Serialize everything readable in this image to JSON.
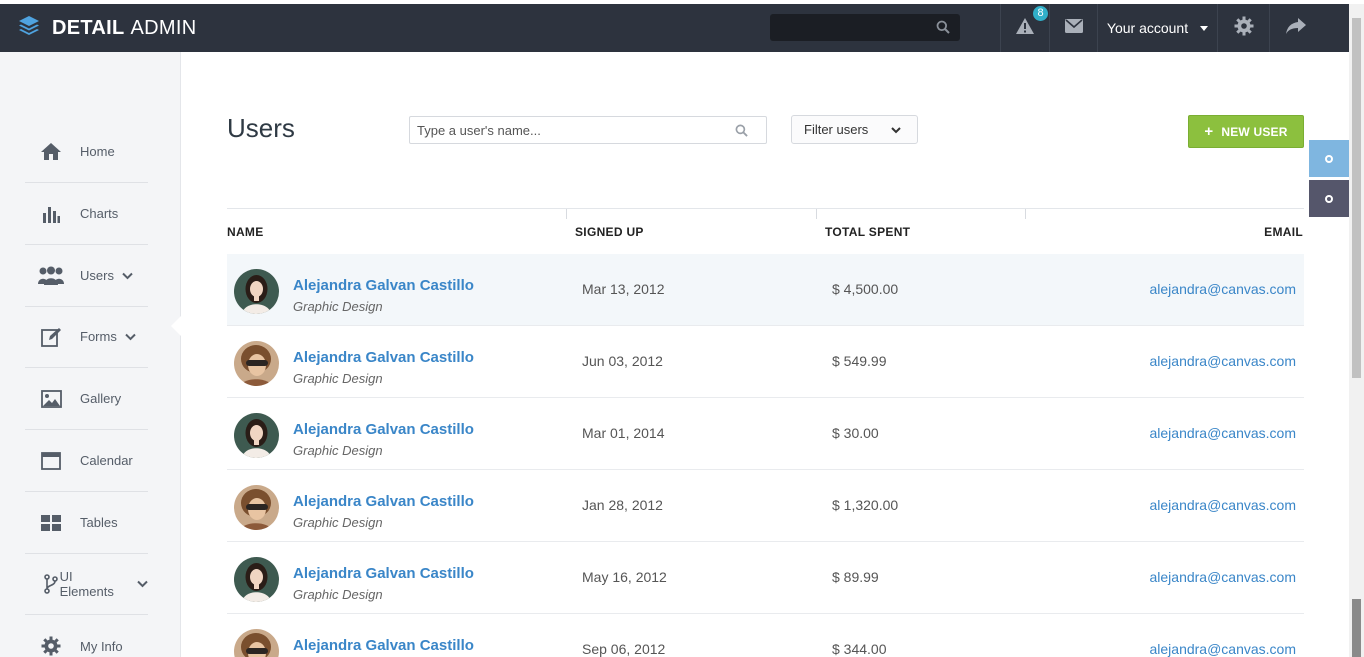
{
  "app": {
    "brand_bold": "DETAIL",
    "brand_light": "ADMIN"
  },
  "topbar": {
    "search_placeholder": "",
    "alerts_count": "8",
    "account_label": "Your account",
    "icons": [
      "search-icon",
      "alert-icon",
      "mail-icon",
      "gear-icon",
      "share-icon"
    ]
  },
  "sidebar": {
    "items": [
      {
        "label": "Home",
        "icon": "home-icon"
      },
      {
        "label": "Charts",
        "icon": "bar-chart-icon"
      },
      {
        "label": "Users",
        "icon": "users-icon",
        "expandable": true
      },
      {
        "label": "Forms",
        "icon": "edit-icon",
        "expandable": true
      },
      {
        "label": "Gallery",
        "icon": "image-icon"
      },
      {
        "label": "Calendar",
        "icon": "calendar-icon"
      },
      {
        "label": "Tables",
        "icon": "grid-icon"
      },
      {
        "label": "UI Elements",
        "icon": "branch-icon",
        "expandable": true
      },
      {
        "label": "My Info",
        "icon": "gear-icon"
      }
    ],
    "active": "Users"
  },
  "main": {
    "title": "Users",
    "search_placeholder": "Type a user's name...",
    "filter_label": "Filter users",
    "new_user_label": "NEW USER"
  },
  "table": {
    "columns": [
      "NAME",
      "SIGNED UP",
      "TOTAL SPENT",
      "EMAIL"
    ],
    "rows": [
      {
        "name": "Alejandra Galvan Castillo",
        "role": "Graphic Design",
        "signed_up": "Mar 13, 2012",
        "spent": "$ 4,500.00",
        "email": "alejandra@canvas.com",
        "avatar": "a"
      },
      {
        "name": "Alejandra Galvan Castillo",
        "role": "Graphic Design",
        "signed_up": "Jun 03, 2012",
        "spent": "$ 549.99",
        "email": "alejandra@canvas.com",
        "avatar": "b"
      },
      {
        "name": "Alejandra Galvan Castillo",
        "role": "Graphic Design",
        "signed_up": "Mar 01, 2014",
        "spent": "$ 30.00",
        "email": "alejandra@canvas.com",
        "avatar": "a"
      },
      {
        "name": "Alejandra Galvan Castillo",
        "role": "Graphic Design",
        "signed_up": "Jan 28, 2012",
        "spent": "$ 1,320.00",
        "email": "alejandra@canvas.com",
        "avatar": "b"
      },
      {
        "name": "Alejandra Galvan Castillo",
        "role": "Graphic Design",
        "signed_up": "May 16, 2012",
        "spent": "$ 89.99",
        "email": "alejandra@canvas.com",
        "avatar": "a"
      },
      {
        "name": "Alejandra Galvan Castillo",
        "role": "Graphic Design",
        "signed_up": "Sep 06, 2012",
        "spent": "$ 344.00",
        "email": "alejandra@canvas.com",
        "avatar": "b"
      }
    ]
  },
  "colors": {
    "topbar": "#2d333e",
    "accent_green": "#8cc03e",
    "link_blue": "#3a86c8",
    "float_light": "#7fb6e0",
    "float_dark": "#55566b"
  }
}
